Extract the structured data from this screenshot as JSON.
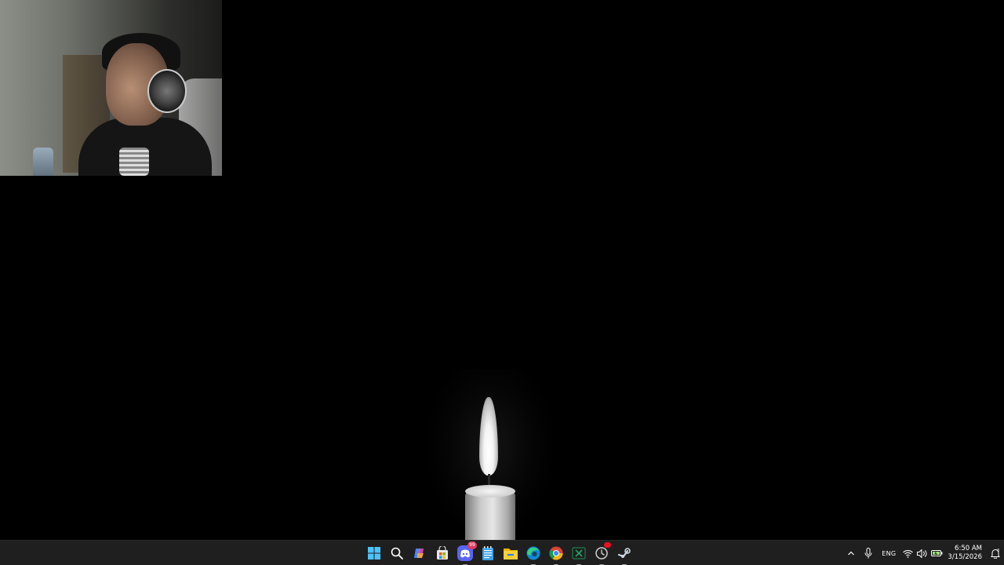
{
  "desktop": {
    "wallpaper": "black background with a single lit candle"
  },
  "webcam": {
    "description": "webcam overlay of streamer wearing headphones"
  },
  "taskbar": {
    "pinned": [
      {
        "name": "start-button",
        "icon": "windows-icon"
      },
      {
        "name": "search-button",
        "icon": "search-icon"
      },
      {
        "name": "copilot-button",
        "icon": "copilot-icon"
      },
      {
        "name": "microsoft-store-button",
        "icon": "store-icon"
      },
      {
        "name": "discord-button",
        "icon": "discord-icon",
        "badge": "99"
      },
      {
        "name": "notepad-button",
        "icon": "notepad-icon"
      },
      {
        "name": "file-explorer-button",
        "icon": "folder-icon"
      },
      {
        "name": "edge-button",
        "icon": "edge-icon"
      },
      {
        "name": "chrome-button",
        "icon": "chrome-icon"
      },
      {
        "name": "excel-button",
        "icon": "excel-icon"
      },
      {
        "name": "tracker-button",
        "icon": "clock-app-icon"
      },
      {
        "name": "steam-button",
        "icon": "steam-icon"
      }
    ],
    "tray": {
      "language": "ENG",
      "time": "6:50 AM",
      "date": "3/15/2026"
    }
  },
  "colors": {
    "taskbar_bg": "#1f1f1f",
    "windows_blue": "#4cc2ff",
    "discord_purple": "#5865f2",
    "badge_red": "#e81123"
  }
}
